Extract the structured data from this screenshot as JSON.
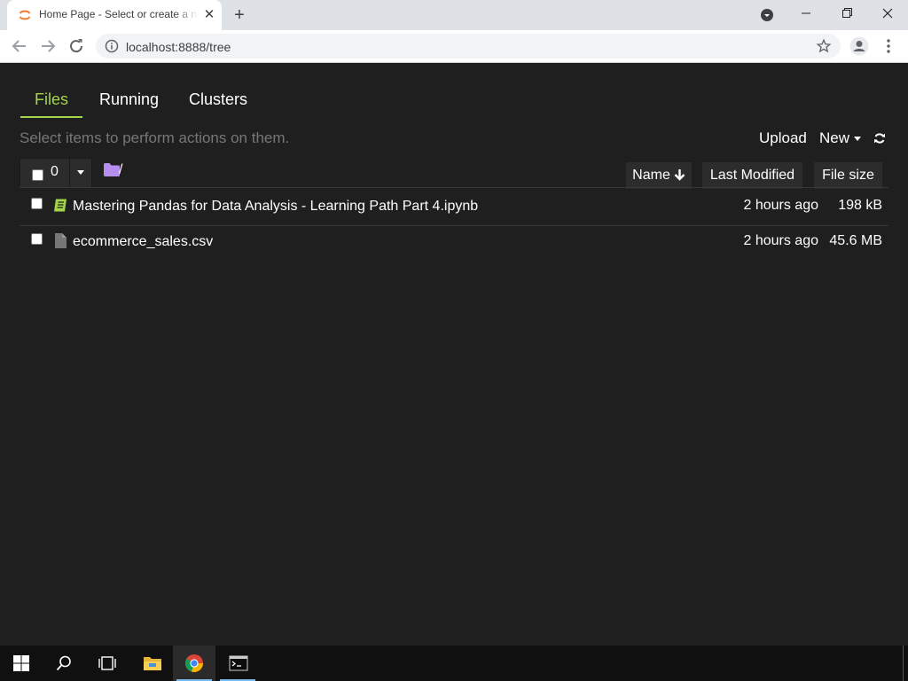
{
  "browser": {
    "tab_title": "Home Page - Select or create a notebook",
    "tab_close": "✕",
    "new_tab": "+",
    "url": "localhost:8888/tree"
  },
  "jupyter": {
    "tabs": [
      {
        "label": "Files",
        "active": true
      },
      {
        "label": "Running",
        "active": false
      },
      {
        "label": "Clusters",
        "active": false
      }
    ],
    "hint": "Select items to perform actions on them.",
    "upload_label": "Upload",
    "new_label": "New",
    "selected_count": "0",
    "breadcrumb": "/",
    "columns": {
      "name": "Name",
      "last_modified": "Last Modified",
      "file_size": "File size"
    },
    "files": [
      {
        "icon": "notebook-icon",
        "name": "Mastering Pandas for Data Analysis - Learning Path Part 4.ipynb",
        "modified": "2 hours ago",
        "size": "198 kB"
      },
      {
        "icon": "file-icon",
        "name": "ecommerce_sales.csv",
        "modified": "2 hours ago",
        "size": "45.6 MB"
      }
    ]
  },
  "taskbar": {
    "items": [
      "windows-start-icon",
      "search-icon",
      "task-view-icon",
      "file-explorer-icon",
      "chrome-icon",
      "terminal-icon"
    ],
    "active": "chrome-icon"
  },
  "colors": {
    "page_bg": "#1f1f1f",
    "accent_green": "#a3d44a",
    "folder_purple": "#b58ef0",
    "muted_text": "#777777"
  }
}
